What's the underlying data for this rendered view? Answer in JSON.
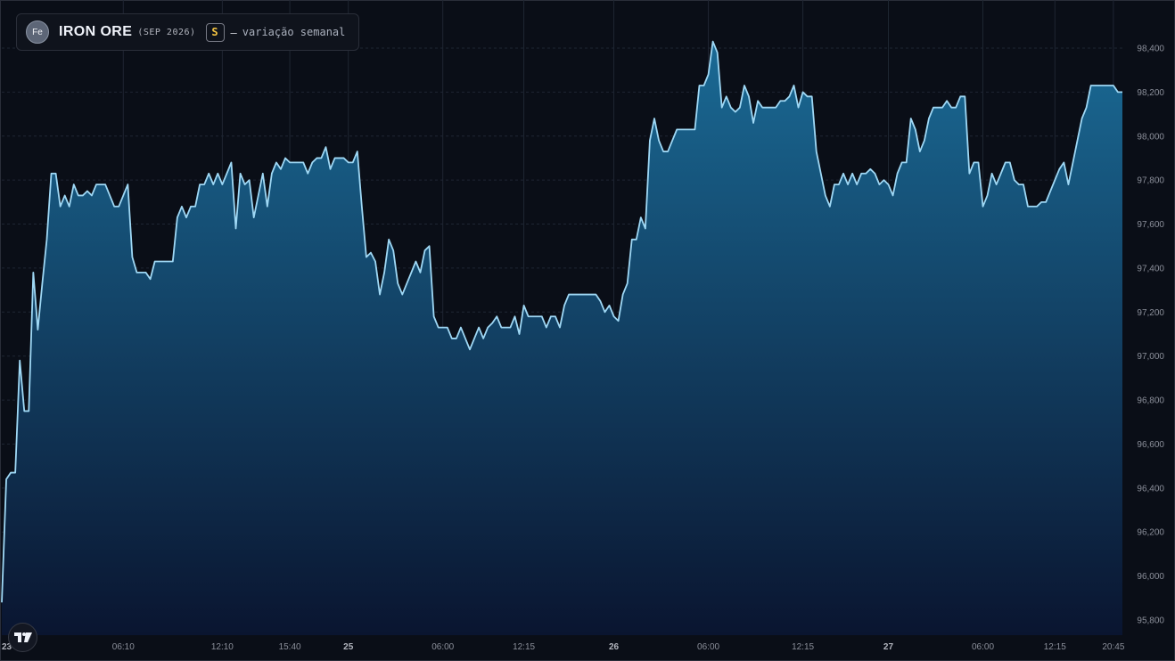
{
  "legend": {
    "icon_text": "Fe",
    "symbol": "IRON ORE",
    "contract": "(SEP 2026)",
    "badge": "S",
    "dash": "–",
    "description": "variação semanal"
  },
  "colors": {
    "background": "#0a0e17",
    "line": "#9fd8f5",
    "fill_top": "#1a6a95",
    "fill_bottom": "#0a1530",
    "grid": "#1f2633",
    "axis_text": "#8b8f9a"
  },
  "chart_data": {
    "type": "area",
    "title": "",
    "xlabel": "",
    "ylabel": "",
    "ylim": [
      95700,
      98500
    ],
    "y_ticks": [
      95800,
      96000,
      96200,
      96400,
      96600,
      96800,
      97000,
      97200,
      97400,
      97600,
      97800,
      98000,
      98200,
      98400
    ],
    "y_tick_labels": [
      "95,800",
      "96,000",
      "96,200",
      "96,400",
      "96,600",
      "96,800",
      "97,000",
      "97,200",
      "97,400",
      "97,600",
      "97,800",
      "98,000",
      "98,200",
      "98,400"
    ],
    "x_ticks": [
      {
        "label": "23",
        "i": 0,
        "bold": true
      },
      {
        "label": "06:10",
        "i": 27,
        "bold": false
      },
      {
        "label": "12:10",
        "i": 49,
        "bold": false
      },
      {
        "label": "15:40",
        "i": 64,
        "bold": false
      },
      {
        "label": "25",
        "i": 77,
        "bold": true
      },
      {
        "label": "06:00",
        "i": 98,
        "bold": false
      },
      {
        "label": "12:15",
        "i": 116,
        "bold": false
      },
      {
        "label": "26",
        "i": 136,
        "bold": true
      },
      {
        "label": "06:00",
        "i": 157,
        "bold": false
      },
      {
        "label": "12:15",
        "i": 178,
        "bold": false
      },
      {
        "label": "27",
        "i": 197,
        "bold": true
      },
      {
        "label": "06:00",
        "i": 218,
        "bold": false
      },
      {
        "label": "12:15",
        "i": 234,
        "bold": false
      },
      {
        "label": "20:45",
        "i": 247,
        "bold": false
      }
    ],
    "grid": true,
    "series": [
      {
        "values": [
          95880,
          96440,
          96470,
          96470,
          96980,
          96750,
          96750,
          97380,
          97120,
          97330,
          97530,
          97830,
          97830,
          97680,
          97730,
          97680,
          97780,
          97730,
          97730,
          97750,
          97730,
          97780,
          97780,
          97780,
          97730,
          97680,
          97680,
          97730,
          97780,
          97450,
          97380,
          97380,
          97380,
          97350,
          97430,
          97430,
          97430,
          97430,
          97430,
          97630,
          97680,
          97630,
          97680,
          97680,
          97780,
          97780,
          97830,
          97780,
          97830,
          97780,
          97830,
          97880,
          97580,
          97830,
          97780,
          97800,
          97630,
          97730,
          97830,
          97680,
          97830,
          97880,
          97850,
          97900,
          97880,
          97880,
          97880,
          97880,
          97830,
          97880,
          97900,
          97900,
          97950,
          97850,
          97900,
          97900,
          97900,
          97880,
          97880,
          97930,
          97680,
          97450,
          97470,
          97430,
          97280,
          97380,
          97530,
          97480,
          97330,
          97280,
          97330,
          97380,
          97430,
          97380,
          97480,
          97500,
          97180,
          97130,
          97130,
          97130,
          97080,
          97080,
          97130,
          97080,
          97030,
          97080,
          97130,
          97080,
          97130,
          97150,
          97180,
          97130,
          97130,
          97130,
          97180,
          97100,
          97230,
          97180,
          97180,
          97180,
          97180,
          97130,
          97180,
          97180,
          97130,
          97230,
          97280,
          97280,
          97280,
          97280,
          97280,
          97280,
          97280,
          97250,
          97200,
          97230,
          97180,
          97160,
          97280,
          97330,
          97530,
          97530,
          97630,
          97580,
          97980,
          98080,
          97980,
          97930,
          97930,
          97980,
          98030,
          98030,
          98030,
          98030,
          98030,
          98230,
          98230,
          98280,
          98430,
          98380,
          98130,
          98180,
          98130,
          98110,
          98130,
          98230,
          98180,
          98060,
          98160,
          98130,
          98130,
          98130,
          98130,
          98160,
          98160,
          98180,
          98230,
          98130,
          98200,
          98180,
          98180,
          97930,
          97830,
          97730,
          97680,
          97780,
          97780,
          97830,
          97780,
          97830,
          97780,
          97830,
          97830,
          97850,
          97830,
          97780,
          97800,
          97780,
          97730,
          97830,
          97880,
          97880,
          98080,
          98030,
          97930,
          97980,
          98080,
          98130,
          98130,
          98130,
          98160,
          98130,
          98130,
          98180,
          98180,
          97830,
          97880,
          97880,
          97680,
          97730,
          97830,
          97780,
          97830,
          97880,
          97880,
          97800,
          97780,
          97780,
          97680,
          97680,
          97680,
          97700,
          97700,
          97750,
          97800,
          97850,
          97880,
          97780,
          97880,
          97980,
          98080,
          98130,
          98230,
          98230,
          98230,
          98230,
          98230,
          98230,
          98200,
          98200
        ]
      }
    ]
  }
}
